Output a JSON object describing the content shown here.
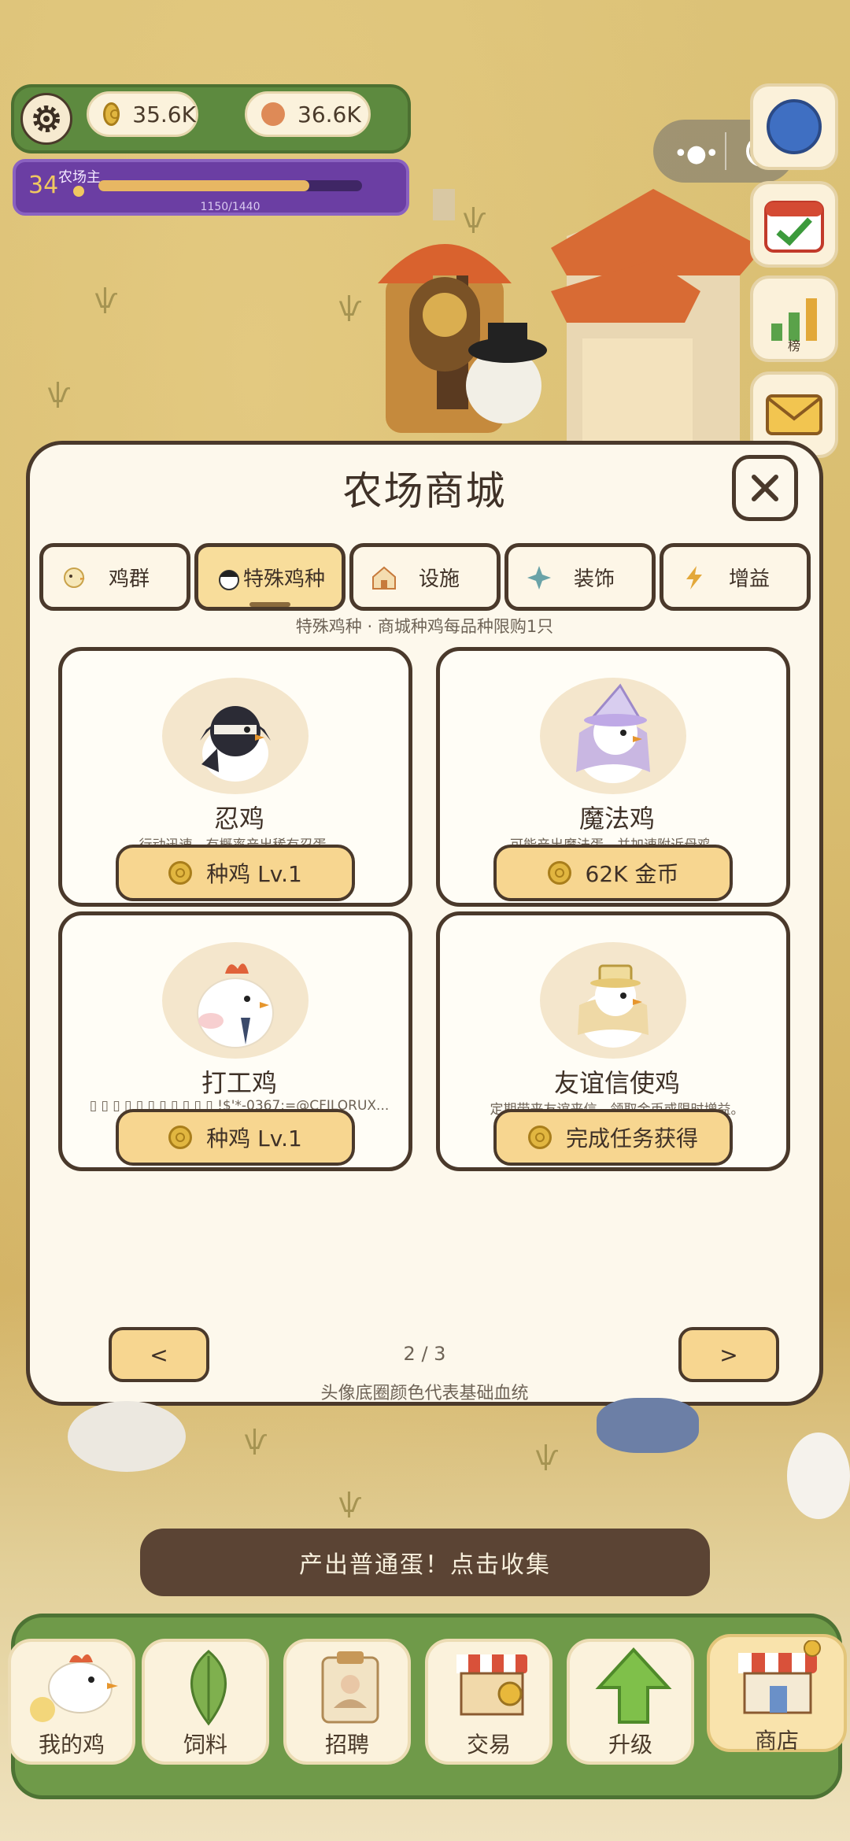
{
  "hud": {
    "coins": "35.6K",
    "beans": "36.6K",
    "level": "34",
    "rank_title": "农场主",
    "xp_text": "1150/1440",
    "xp_progress": 0.7986
  },
  "side_buttons": {
    "leaderboard_label": "榜"
  },
  "shop": {
    "title": "农场商城",
    "tabs": [
      {
        "label": "鸡群"
      },
      {
        "label": "特殊鸡种"
      },
      {
        "label": "设施"
      },
      {
        "label": "装饰"
      },
      {
        "label": "增益"
      }
    ],
    "subnote": "特殊鸡种 · 商城种鸡每品种限购1只",
    "cards": [
      {
        "name": "忍鸡",
        "desc": "行动迅速，有概率产出稀有忍蛋。",
        "button": "种鸡 Lv.1"
      },
      {
        "name": "魔法鸡",
        "desc": "可能产出魔法蛋，并加速附近母鸡。",
        "button": "62K 金币"
      },
      {
        "name": "打工鸡",
        "desc": "▯ ▯ ▯ ▯ ▯ ▯ ▯ ▯ ▯ ▯ ▯ !$'*-0367:=@CFILORUX...",
        "button": "种鸡 Lv.1"
      },
      {
        "name": "友谊信使鸡",
        "desc": "定期带来友谊来信，领取金币或限时增益。",
        "button": "完成任务获得"
      }
    ],
    "prev": "<",
    "next": ">",
    "page": "2 / 3",
    "footnote": "头像底圈颜色代表基础血统"
  },
  "collect_banner": "产出普通蛋！点击收集",
  "bottom_nav": [
    {
      "label": "我的鸡"
    },
    {
      "label": "饲料"
    },
    {
      "label": "招聘"
    },
    {
      "label": "交易"
    },
    {
      "label": "升级"
    },
    {
      "label": "商店"
    }
  ]
}
